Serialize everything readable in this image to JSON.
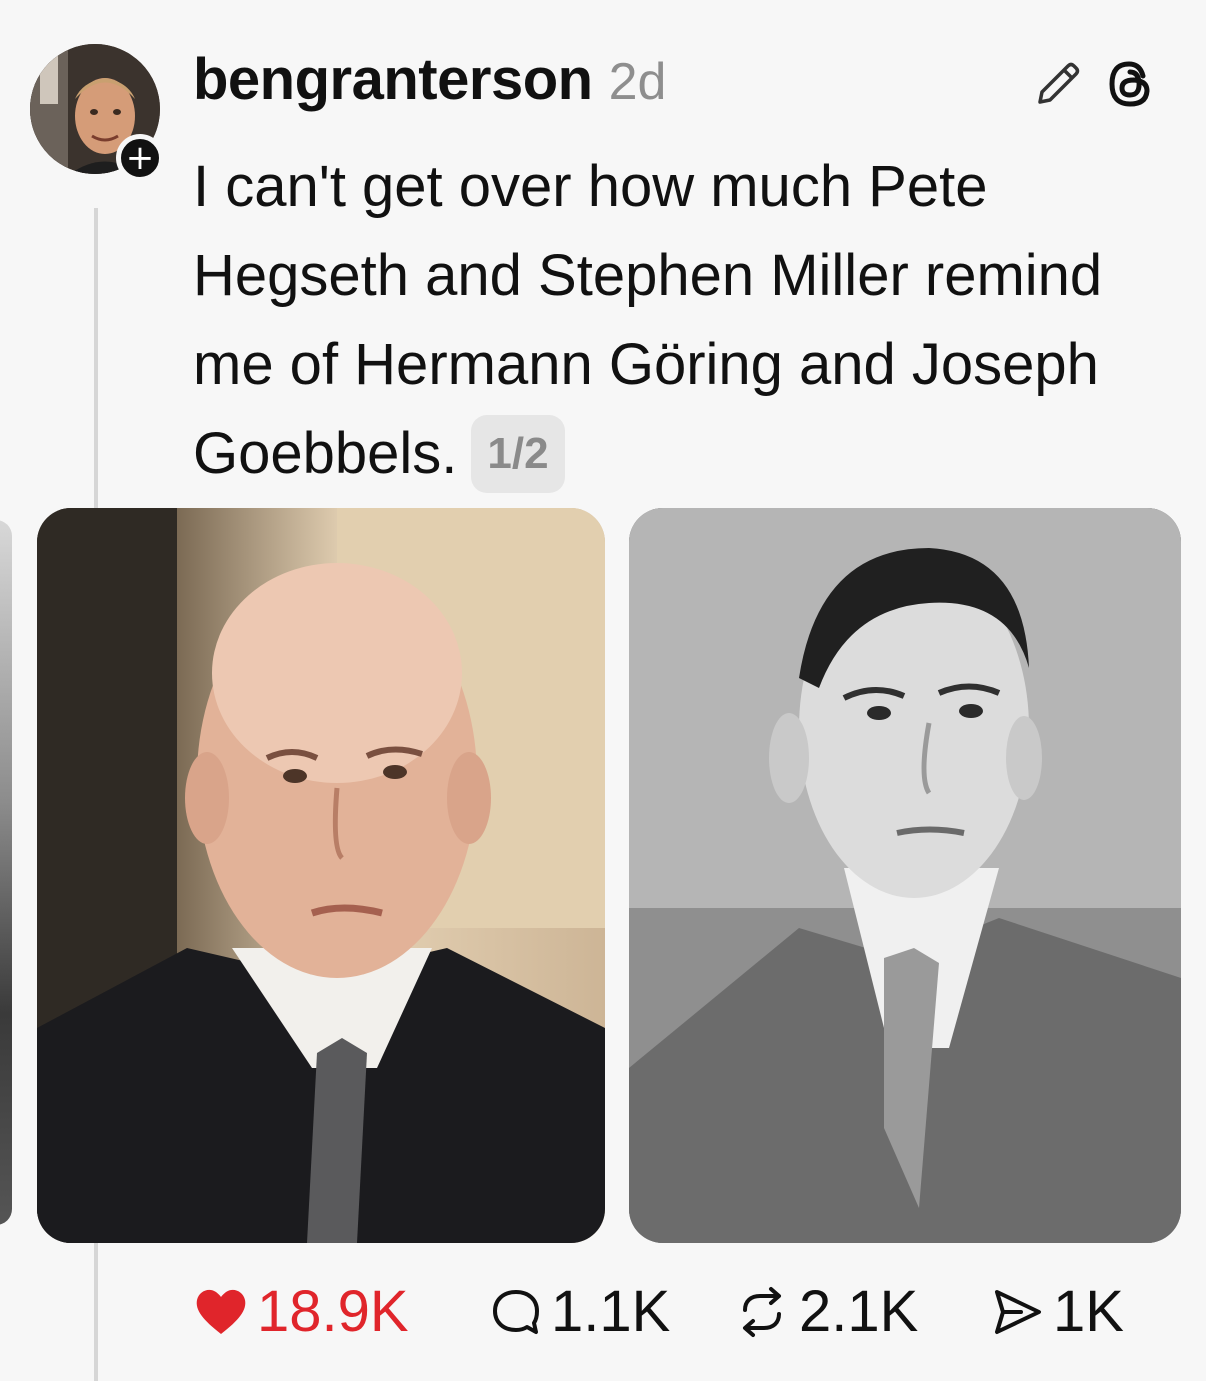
{
  "post": {
    "username": "bengranterson",
    "timestamp": "2d",
    "text": "I can't get over how much Pete Hegseth and Stephen Miller remind me of Hermann Göring and Joseph Goebbels.",
    "thread_counter": "1/2",
    "icons": {
      "avatar": "profile-photo",
      "follow": "plus-icon",
      "edit": "pencil-icon",
      "app": "threads-logo-icon"
    }
  },
  "actions": {
    "like_count": "18.9K",
    "reply_count": "1.1K",
    "repost_count": "2.1K",
    "share_count": "1K"
  },
  "colors": {
    "like": "#e0252b",
    "text": "#111111",
    "muted": "#8e8e8e",
    "background": "#f7f7f7"
  }
}
